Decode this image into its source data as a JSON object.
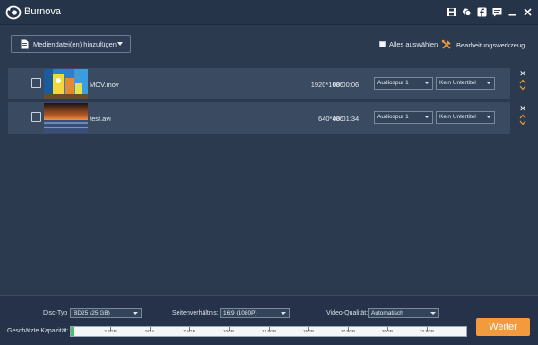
{
  "app": {
    "title": "Burnova"
  },
  "titlebar_icons": [
    "save-icon",
    "chat-icon",
    "facebook-icon",
    "feedback-icon",
    "minimize-icon",
    "close-icon"
  ],
  "toolbar": {
    "add_media_label": "Mediendatei(en) hinzufügen",
    "select_all_label": "Alles auswählen",
    "edit_tool_label": "Bearbeitungswerkzeug"
  },
  "files": [
    {
      "name": "MOV.mov",
      "resolution": "1920*1080",
      "duration": "00:00:06",
      "audio": "Audiospur 1",
      "subtitle": "Kein Untertitel"
    },
    {
      "name": "test.avi",
      "resolution": "640*480",
      "duration": "00:01:34",
      "audio": "Audiospur 1",
      "subtitle": "Kein Untertitel"
    }
  ],
  "bottom": {
    "disc_type_label": "Disc-Typ",
    "disc_type_value": "BD25 (25 GB)",
    "aspect_label": "Seitenverhältnis:",
    "aspect_value": "16:9 (1080P)",
    "quality_label": "Video-Qualität:",
    "quality_value": "Automatisch",
    "capacity_label": "Geschätzte Kapazität:",
    "capacity_used_fraction": 0.005,
    "capacity_ticks": [
      "2.5GB",
      "5GB",
      "7.5GB",
      "10GB",
      "12.5GB",
      "15GB",
      "17.5GB",
      "20GB",
      "22.5GB"
    ],
    "next_label": "Weiter"
  },
  "colors": {
    "accent": "#f29a3c",
    "background": "#2b3a4f",
    "row": "#394a61",
    "capacity_fill": "#46c26e"
  }
}
